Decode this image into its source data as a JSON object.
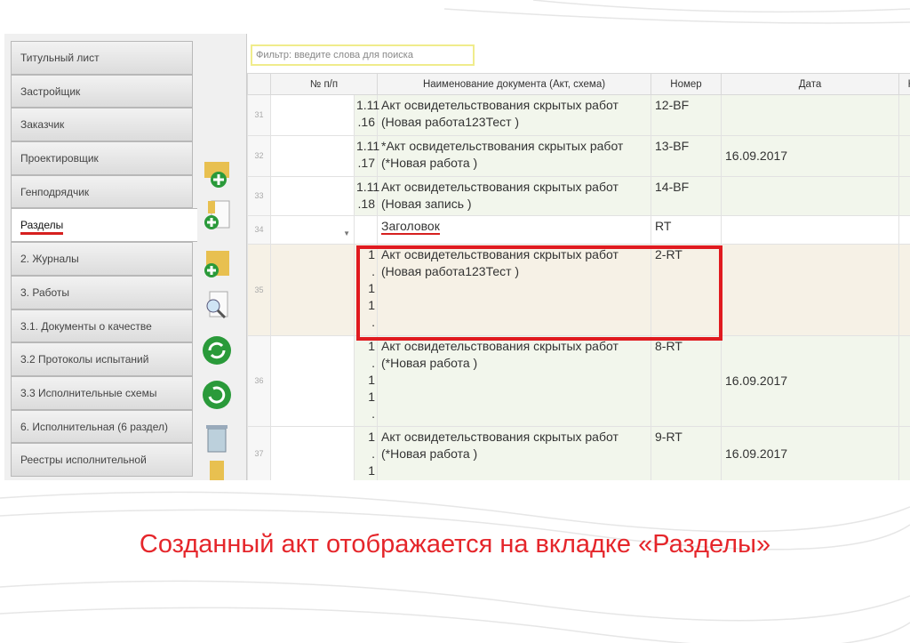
{
  "tabs": [
    "Титульный лист",
    "Застройщик",
    "Заказчик",
    "Проектировщик",
    "Генподрядчик",
    "Разделы",
    "2. Журналы",
    "3. Работы",
    "3.1. Документы о качестве",
    "3.2 Протоколы испытаний",
    "3.3 Исполнительные схемы",
    "6. Исполнительная (6 раздел)",
    "Реестры исполнительной"
  ],
  "active_tab": "Разделы",
  "filter": {
    "placeholder": "Фильтр: введите слова для поиска"
  },
  "columns": [
    "№ п/п",
    "Наименование документа (Акт, схема)",
    "Номер",
    "Дата",
    "К"
  ],
  "rows": [
    {
      "rn": "31",
      "num": "1.11\n.16",
      "name": "Акт освидетельствования скрытых работ (Новая работа123Тест )",
      "code": "12-BF",
      "date": ""
    },
    {
      "rn": "32",
      "num": "1.11\n.17",
      "name": "*Акт освидетельствования скрытых работ (*Новая работа )",
      "code": "13-BF",
      "date": "16.09.2017"
    },
    {
      "rn": "33",
      "num": "1.11\n.18",
      "name": "Акт освидетельствования скрытых работ (Новая запись )",
      "code": "14-BF",
      "date": ""
    },
    {
      "rn": "34",
      "num": "",
      "name": "Заголовок",
      "code": "RT",
      "date": ""
    },
    {
      "rn": "35",
      "num": "1\n.\n1\n1\n.",
      "name": "Акт освидетельствования скрытых работ (Новая работа123Тест )",
      "code": "2-RT",
      "date": ""
    },
    {
      "rn": "36",
      "num": "1\n.\n1\n1\n.",
      "name": "Акт освидетельствования скрытых работ (*Новая работа )",
      "code": "8-RT",
      "date": "16.09.2017"
    },
    {
      "rn": "37",
      "num": "1\n.\n1",
      "name": "Акт освидетельствования скрытых работ (*Новая работа )",
      "code": "9-RT",
      "date": "16.09.2017"
    }
  ],
  "caption": "Созданный акт отображается на вкладке «Разделы»",
  "colors": {
    "accent": "#e5262b",
    "highlight_box": "#e01a1f"
  }
}
